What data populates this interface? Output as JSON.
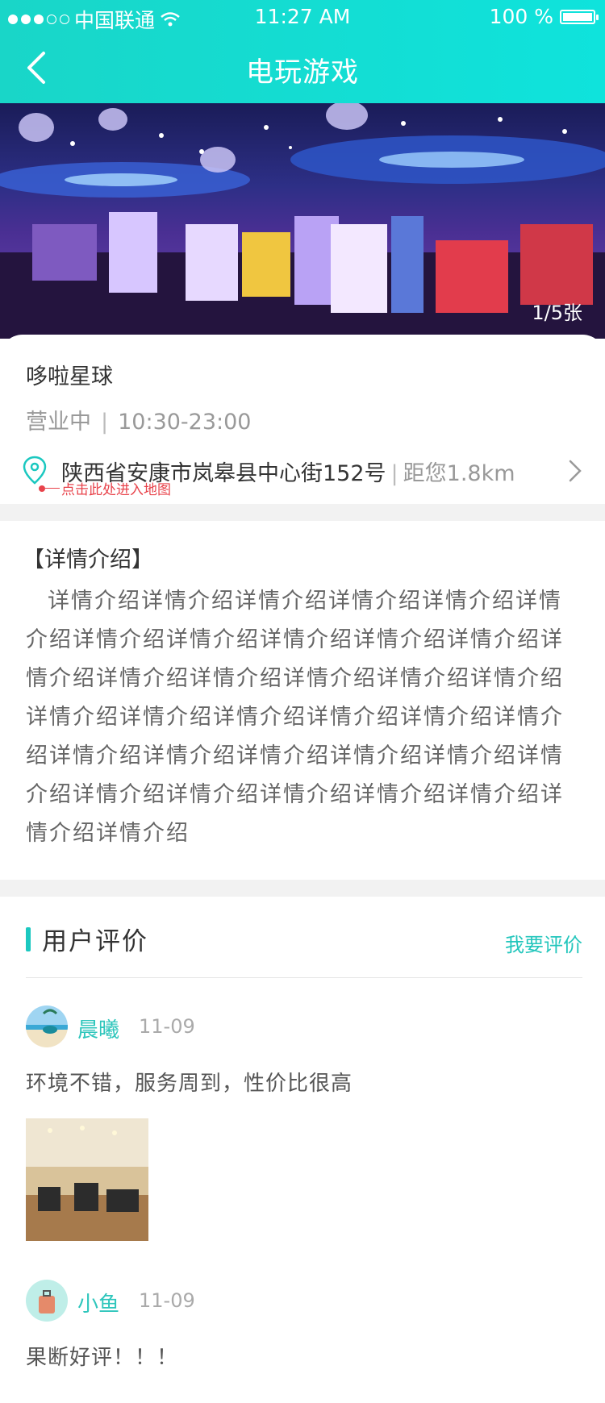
{
  "status_bar": {
    "carrier": "中国联通",
    "time": "11:27 AM",
    "battery": "100 %"
  },
  "nav": {
    "title": "电玩游戏"
  },
  "gallery": {
    "counter": "1/5张"
  },
  "shop": {
    "name": "哆啦星球",
    "open_status": "营业中",
    "hours_sep": "|",
    "hours": "10:30-23:00",
    "address": "陕西省安康市岚皋县中心街152号",
    "distance_sep": "|",
    "distance": "距您1.8km",
    "map_hint": "点击此处进入地图"
  },
  "detail": {
    "title": "【详情介绍】",
    "body": "详情介绍详情介绍详情介绍详情介绍详情介绍详情介绍详情介绍详情介绍详情介绍详情介绍详情介绍详情介绍详情介绍详情介绍详情介绍详情介绍详情介绍详情介绍详情介绍详情介绍详情介绍详情介绍详情介绍详情介绍详情介绍详情介绍详情介绍详情介绍详情介绍详情介绍详情介绍详情介绍详情介绍详情介绍详情介绍详情介绍"
  },
  "reviews": {
    "title": "用户评价",
    "write_link": "我要评价",
    "items": [
      {
        "name": "晨曦",
        "date": "11-09",
        "text": "环境不错，服务周到，性价比很高"
      },
      {
        "name": "小鱼",
        "date": "11-09",
        "text": "果断好评！！！"
      }
    ]
  },
  "colors": {
    "accent": "#1bc8c0",
    "header_gradient_start": "#19d6c8",
    "header_gradient_end": "#0fe3dc",
    "map_hint": "#e8434b"
  }
}
